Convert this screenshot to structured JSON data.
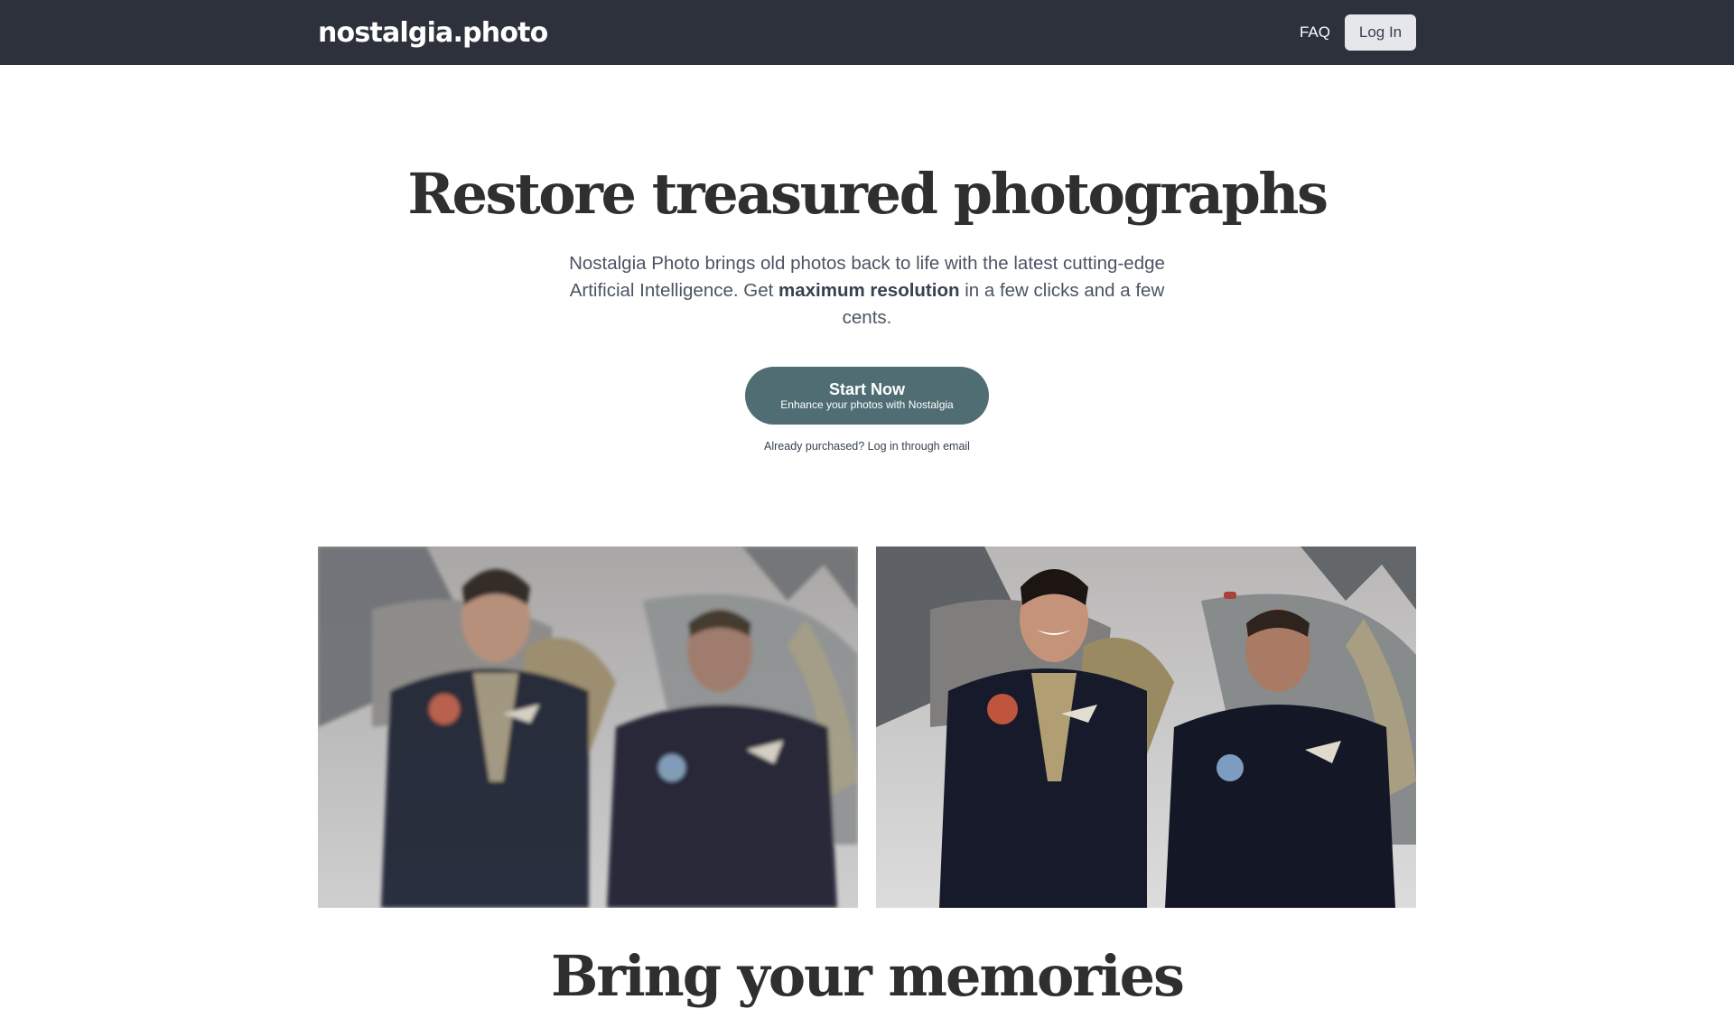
{
  "header": {
    "brand": "nostalgia.photo",
    "nav": {
      "faq_label": "FAQ",
      "login_label": "Log In"
    }
  },
  "hero": {
    "title": "Restore treasured photographs",
    "subtitle_part1": "Nostalgia Photo brings old photos back to life with the latest cutting-edge Artificial Intelligence. Get ",
    "subtitle_bold": "maximum resolution",
    "subtitle_part2": " in a few clicks and a few cents.",
    "cta": {
      "title": "Start Now",
      "subtitle": "Enhance your photos with Nostalgia"
    },
    "already_purchased": "Already purchased? Log in through email"
  },
  "comparison": {
    "before_image": "before-photo",
    "after_image": "after-photo"
  },
  "next_section": {
    "heading_partial": "Bring your memories"
  },
  "colors": {
    "header_bg": "#2c313c",
    "cta_bg": "#4f6d73",
    "login_bg": "#e5e7eb"
  }
}
